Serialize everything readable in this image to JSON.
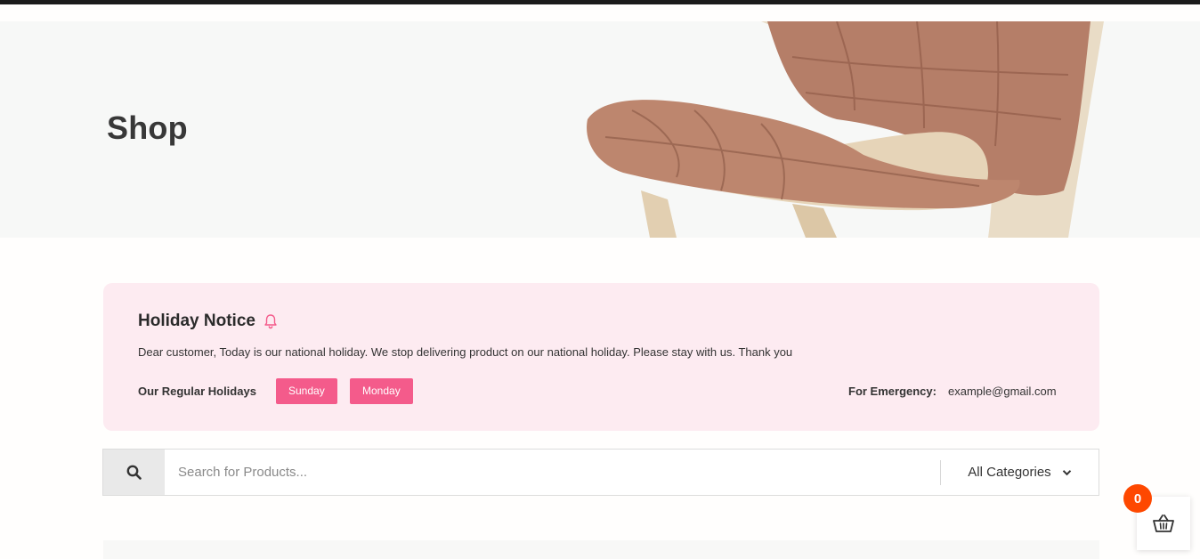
{
  "hero": {
    "title": "Shop"
  },
  "notice": {
    "title": "Holiday Notice",
    "message": "Dear customer, Today is our national holiday. We stop delivering product on our national holiday. Please stay with us. Thank you",
    "holidays_label": "Our Regular Holidays",
    "holidays": [
      "Sunday",
      "Monday"
    ],
    "emergency_label": "For Emergency:",
    "emergency_email": "example@gmail.com"
  },
  "search": {
    "placeholder": "Search for Products...",
    "category": "All Categories"
  },
  "cart": {
    "count": "0"
  },
  "colors": {
    "accent_pink": "#f45b8b",
    "notice_bg": "#fdebf1",
    "cart_badge": "#fe4800"
  },
  "icons": {
    "bell": "bell-icon",
    "search": "search-icon",
    "dropdown": "chevron-down-icon",
    "cart": "basket-icon"
  }
}
